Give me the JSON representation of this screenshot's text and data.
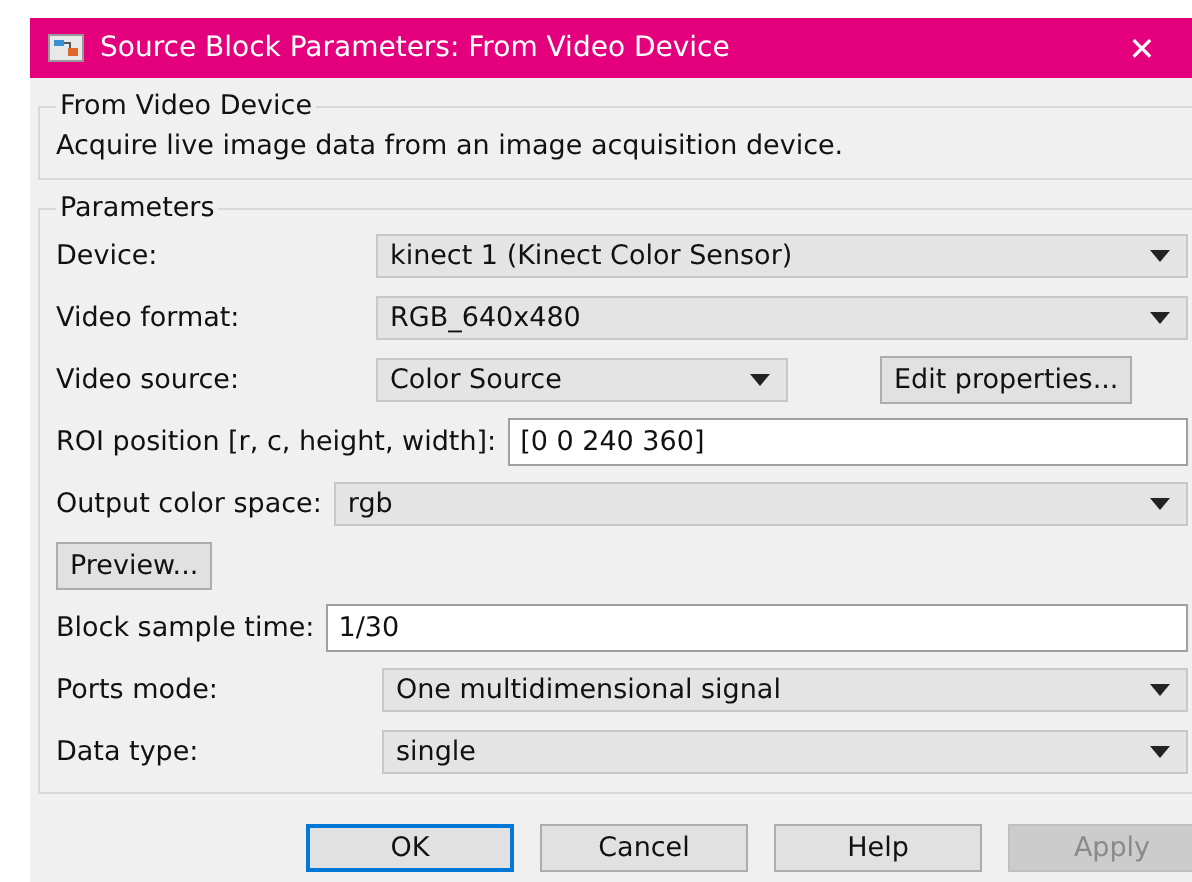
{
  "window": {
    "title": "Source Block Parameters: From Video Device",
    "close": "✕"
  },
  "description": {
    "heading": "From Video Device",
    "text": "Acquire live image data from an image acquisition device."
  },
  "parameters": {
    "heading": "Parameters",
    "rows": [
      {
        "kind": "dropdown",
        "label": "Device:",
        "value": "kinect 1 (Kinect Color Sensor)"
      },
      {
        "kind": "dropdown",
        "label": "Video format:",
        "value": "RGB_640x480"
      },
      {
        "kind": "dropdown",
        "label": "Video source:",
        "value": "Color Source",
        "button": "Edit properties..."
      },
      {
        "kind": "field",
        "label": "ROI position [r, c, height, width]:",
        "value": "[0 0 240 360]"
      },
      {
        "kind": "dropdown",
        "label": "Output color space:",
        "value": "rgb"
      },
      {
        "kind": "button",
        "label": "Preview..."
      },
      {
        "kind": "field",
        "label": "Block sample time:",
        "value": "1/30"
      },
      {
        "kind": "dropdown",
        "label": "Ports mode:",
        "value": "One multidimensional signal"
      },
      {
        "kind": "dropdown",
        "label": "Data type:",
        "value": "single"
      }
    ]
  },
  "buttons": [
    {
      "label": "OK",
      "default": true,
      "disabled": false
    },
    {
      "label": "Cancel",
      "default": false,
      "disabled": false
    },
    {
      "label": "Help",
      "default": false,
      "disabled": false
    },
    {
      "label": "Apply",
      "default": false,
      "disabled": true
    }
  ]
}
